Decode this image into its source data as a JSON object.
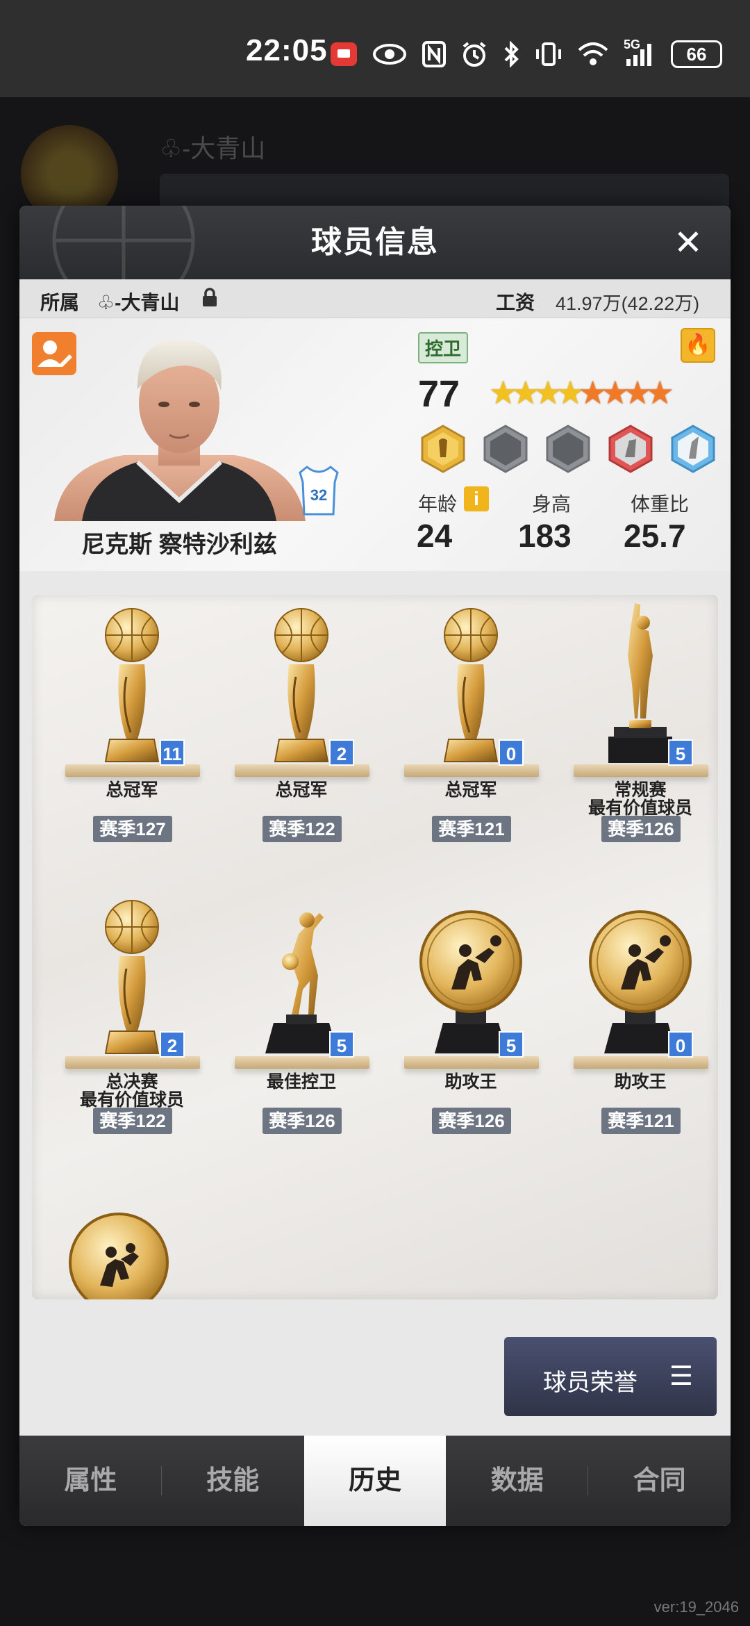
{
  "status_bar": {
    "time": "22:05",
    "network": "5G",
    "battery": "66"
  },
  "background": {
    "team_name": "♧-大青山",
    "version": "ver:19_2046"
  },
  "modal": {
    "title": "球员信息",
    "affiliation_label": "所属",
    "team_name": "♧-大青山",
    "salary_label": "工资",
    "salary_value": "41.97万(42.22万)"
  },
  "player": {
    "name": "尼克斯 察特沙利兹",
    "jersey_number": "32",
    "position": "控卫",
    "rating": "77",
    "stars_gold": 4,
    "stars_orange": 4,
    "age_label": "年龄",
    "age": "24",
    "height_label": "身高",
    "height": "183",
    "weight_ratio_label": "体重比",
    "weight_ratio": "25.7"
  },
  "trophies": [
    {
      "type": "ball",
      "count": "11",
      "name": "总冠军",
      "season": "赛季127"
    },
    {
      "type": "ball",
      "count": "2",
      "name": "总冠军",
      "season": "赛季122"
    },
    {
      "type": "ball",
      "count": "0",
      "name": "总冠军",
      "season": "赛季121"
    },
    {
      "type": "figure",
      "count": "5",
      "name": "常规赛\n最有价值球员",
      "season": "赛季126"
    },
    {
      "type": "ball2",
      "count": "2",
      "name": "总决赛\n最有价值球员",
      "season": "赛季122"
    },
    {
      "type": "runner",
      "count": "5",
      "name": "最佳控卫",
      "season": "赛季126"
    },
    {
      "type": "disc",
      "count": "5",
      "name": "助攻王",
      "season": "赛季126"
    },
    {
      "type": "disc",
      "count": "0",
      "name": "助攻王",
      "season": "赛季121"
    }
  ],
  "honor_button": "球员荣誉",
  "tabs": [
    "属性",
    "技能",
    "历史",
    "数据",
    "合同"
  ],
  "active_tab": "历史",
  "colors": {
    "accent_orange": "#f07f2e",
    "badge_blue": "#3e7ad8",
    "season_tag": "#6d7583"
  }
}
